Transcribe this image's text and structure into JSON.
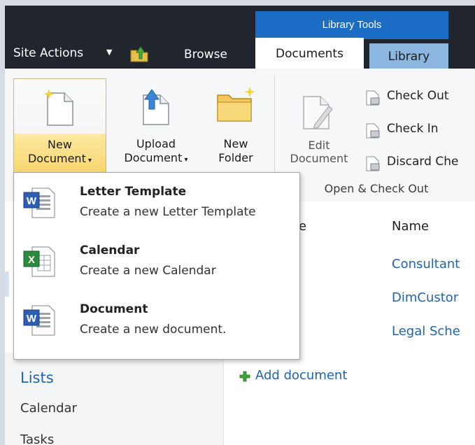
{
  "ribbon_tab_group": "Library Tools",
  "site_actions": "Site Actions",
  "tabs": {
    "browse": "Browse",
    "documents": "Documents",
    "library": "Library"
  },
  "buttons": {
    "new_document": [
      "New",
      "Document"
    ],
    "upload_document": [
      "Upload",
      "Document"
    ],
    "new_folder": [
      "New",
      "Folder"
    ],
    "edit_document": [
      "Edit",
      "Document"
    ]
  },
  "check_group": {
    "check_out": "Check Out",
    "check_in": "Check In",
    "discard": "Discard Che",
    "label": "Open & Check Out"
  },
  "dropdown": [
    {
      "title": "Letter Template",
      "desc": "Create a new Letter Template",
      "icon": "word-icon"
    },
    {
      "title": "Calendar",
      "desc": "Create a new Calendar",
      "icon": "excel-icon"
    },
    {
      "title": "Document",
      "desc": "Create a new document.",
      "icon": "word-icon"
    }
  ],
  "list": {
    "col_partial": "e",
    "col_name": "Name",
    "rows": [
      "Consultant",
      "DimCustor",
      "Legal Sche"
    ],
    "add_document": "Add document"
  },
  "left_nav": {
    "lists": "Lists",
    "items": [
      "Calendar",
      "Tasks"
    ]
  },
  "colors": {
    "topbar": "#21252d",
    "library_tools": "#1a6cc4",
    "library_tab": "#8ab6e0",
    "link": "#1f64ad",
    "hover": "#f7d56a"
  }
}
